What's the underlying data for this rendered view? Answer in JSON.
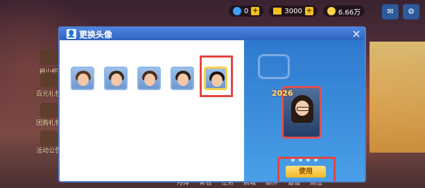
{
  "topbar": {
    "diamond_value": "0",
    "gold_value": "3000",
    "balance_value": "6.66万"
  },
  "sidebar_items": [
    {
      "label": "福小蛇"
    },
    {
      "label": "百元礼包"
    },
    {
      "label": "团购礼包"
    },
    {
      "label": "活动公告"
    }
  ],
  "bottom_nav": [
    "月排",
    "背包",
    "任务",
    "商城",
    "邮件",
    "邀请",
    "商位"
  ],
  "dialog": {
    "title": "更换头像",
    "close": "×",
    "preview_year": "2026",
    "use_label": "使用",
    "avatars": [
      {
        "name": "avatar-1",
        "hair": "#5a3422"
      },
      {
        "name": "avatar-2",
        "hair": "#3a2a20"
      },
      {
        "name": "avatar-3",
        "hair": "#4a2a1e"
      },
      {
        "name": "avatar-4",
        "hair": "#2e201a"
      },
      {
        "name": "avatar-5",
        "hair": "#1c1410",
        "selected": true
      }
    ]
  },
  "colors": {
    "dialog_title": "#3d72cf",
    "highlight_frame": "#e2443f",
    "use_button": "#f2b72a",
    "selected_border": "#f5d24a"
  }
}
